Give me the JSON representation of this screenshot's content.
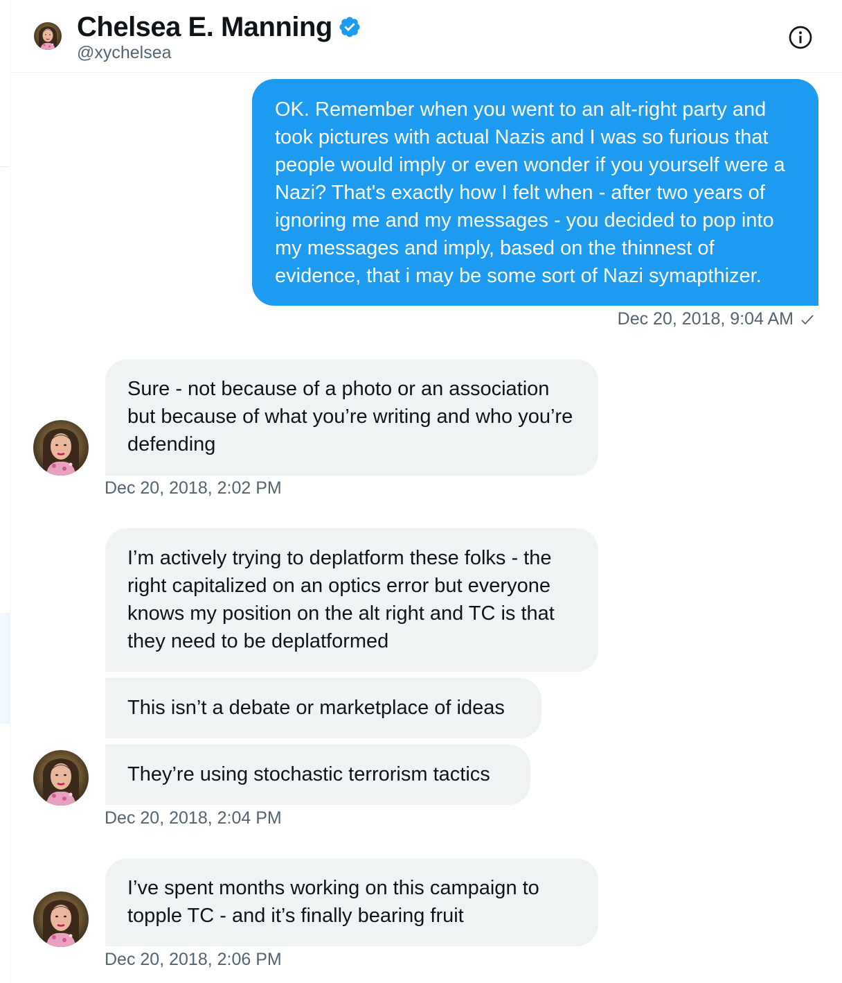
{
  "header": {
    "name": "Chelsea E. Manning",
    "handle": "@xychelsea",
    "verified_color": "#1d9bf0",
    "info_icon": "info-icon"
  },
  "messages": [
    {
      "direction": "sent",
      "text": "OK. Remember when you went to an alt-right party and took pictures with actual Nazis and I was so furious that people would imply or even wonder if you yourself were a Nazi? That's exactly how I felt when - after two years of ignoring me and my messages - you decided to pop into my messages and imply, based on the thinnest of evidence, that i may be some sort of Nazi symapthizer.",
      "timestamp": "Dec 20, 2018, 9:04 AM",
      "status_icon": "checkmark-icon"
    },
    {
      "direction": "received",
      "text": "Sure - not because of a photo or an association but because of what you’re writing and who you’re defending",
      "timestamp": "Dec 20, 2018, 2:02 PM"
    },
    {
      "direction": "received",
      "text": "I’m actively trying to deplatform these folks - the right capitalized on an optics error but everyone knows my position on the alt right and TC is that they need to be deplatformed"
    },
    {
      "direction": "received",
      "text": "This isn’t a debate or marketplace of ideas"
    },
    {
      "direction": "received",
      "text": "They’re using stochastic terrorism tactics",
      "timestamp": "Dec 20, 2018, 2:04 PM"
    },
    {
      "direction": "received",
      "text": "I’ve spent months working on this campaign to topple TC - and it’s finally bearing fruit",
      "timestamp": "Dec 20, 2018, 2:06 PM"
    }
  ],
  "colors": {
    "sent_bubble": "#1d9bf0",
    "received_bubble": "#eff3f4",
    "timestamp_text": "#536471"
  }
}
